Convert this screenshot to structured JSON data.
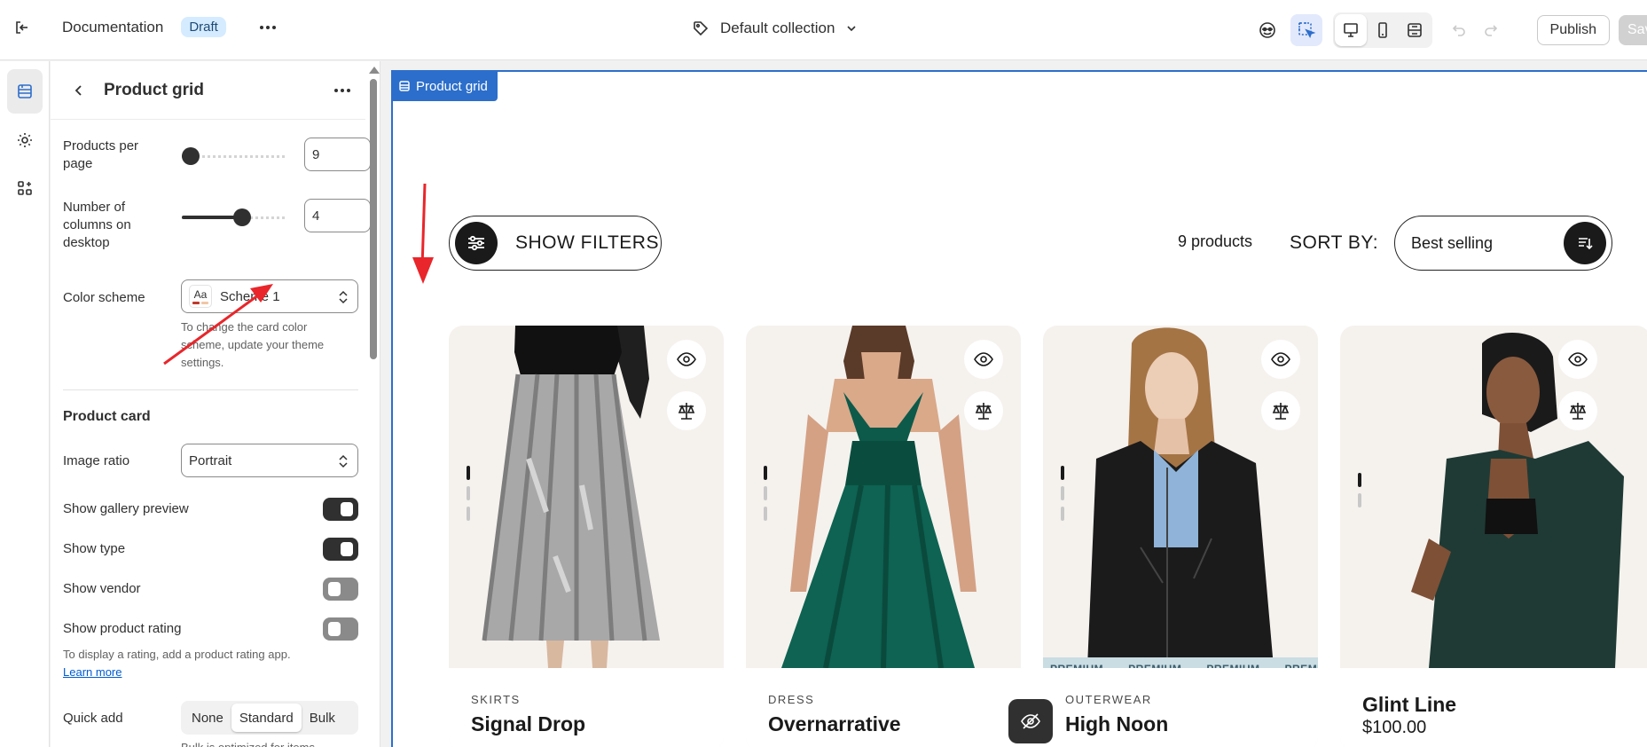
{
  "topbar": {
    "theme_name": "Documentation",
    "status_badge": "Draft",
    "collection": "Default collection",
    "publish_label": "Publish",
    "save_label": "Save"
  },
  "panel": {
    "title": "Product grid",
    "products_per_page": {
      "label": "Products per page",
      "value": "9",
      "slider_fraction": 0.0
    },
    "columns": {
      "label": "Number of columns on desktop",
      "value": "4",
      "slider_fraction": 0.6
    },
    "color_scheme": {
      "label": "Color scheme",
      "value": "Scheme 1",
      "swatch": "Aa",
      "hint": "To change the card color scheme, update your theme settings."
    },
    "product_card": {
      "heading": "Product card",
      "image_ratio": {
        "label": "Image ratio",
        "value": "Portrait"
      },
      "toggles": [
        {
          "label": "Show gallery preview",
          "on": true
        },
        {
          "label": "Show type",
          "on": true
        },
        {
          "label": "Show vendor",
          "on": false
        },
        {
          "label": "Show product rating",
          "on": false
        }
      ],
      "rating_hint": "To display a rating, add a product rating app.",
      "learn_more": "Learn more",
      "quick_add": {
        "label": "Quick add",
        "options": [
          "None",
          "Standard",
          "Bulk"
        ],
        "selected": "Standard"
      },
      "bulk_hint": "Bulk is optimized for items"
    }
  },
  "preview": {
    "section_tag": "Product grid",
    "filters_label": "SHOW FILTERS",
    "count": "9 products",
    "sort_label": "SORT BY:",
    "sort_value": "Best selling",
    "products": [
      {
        "type": "SKIRTS",
        "name": "Signal Drop",
        "price": ""
      },
      {
        "type": "DRESS",
        "name": "Overnarrative",
        "price": ""
      },
      {
        "type": "OUTERWEAR",
        "name": "High Noon",
        "price": "",
        "ribbon": "PREMIUM"
      },
      {
        "type": "",
        "name": "Glint Line",
        "price": "$100.00"
      }
    ]
  },
  "colors": {
    "accent": "#2c6ecb",
    "annotation": "#e8262b",
    "dark": "#303030"
  }
}
